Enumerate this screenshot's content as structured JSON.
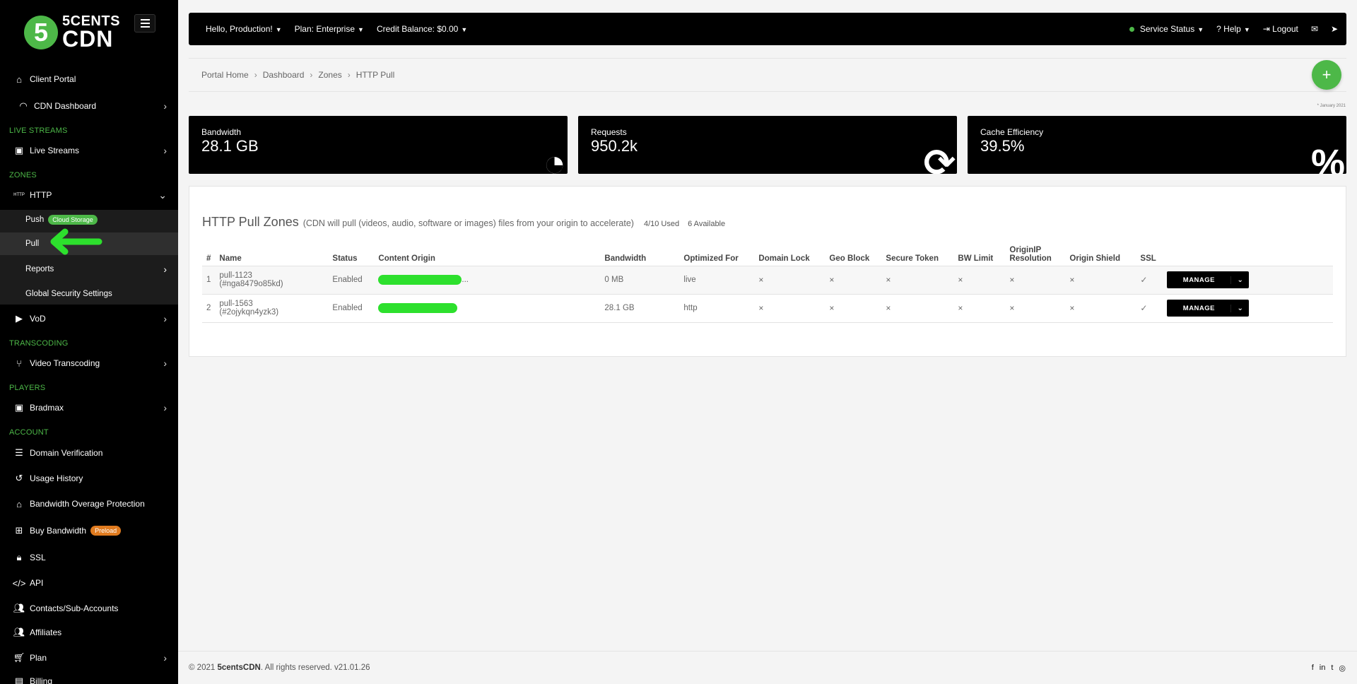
{
  "brand": {
    "logo_mark": "5",
    "line1": "5CENTS",
    "line2": "CDN"
  },
  "sidebar": {
    "client_portal": "Client Portal",
    "cdn_dashboard": "CDN Dashboard",
    "section_live": "LIVE STREAMS",
    "live_streams": "Live Streams",
    "section_zones": "ZONES",
    "http": "HTTP",
    "push": "Push",
    "push_badge": "Cloud Storage",
    "pull": "Pull",
    "reports": "Reports",
    "global_security": "Global Security Settings",
    "vod": "VoD",
    "section_transcoding": "TRANSCODING",
    "video_transcoding": "Video Transcoding",
    "section_players": "PLAYERS",
    "bradmax": "Bradmax",
    "section_account": "ACCOUNT",
    "domain_verification": "Domain Verification",
    "usage_history": "Usage History",
    "bw_overage": "Bandwidth Overage Protection",
    "buy_bandwidth": "Buy Bandwidth",
    "buy_badge": "Preload",
    "ssl": "SSL",
    "api": "API",
    "contacts": "Contacts/Sub-Accounts",
    "affiliates": "Affiliates",
    "plan": "Plan",
    "billing": "Billing"
  },
  "topbar": {
    "hello": "Hello, Production!",
    "plan": "Plan: Enterprise",
    "credit": "Credit Balance: $0.00",
    "service_status": "Service Status",
    "help": "Help",
    "logout": "Logout"
  },
  "breadcrumb": [
    "Portal Home",
    "Dashboard",
    "Zones",
    "HTTP Pull"
  ],
  "date_note": "* January 2021",
  "stats": [
    {
      "label": "Bandwidth",
      "value": "28.1 GB"
    },
    {
      "label": "Requests",
      "value": "950.2k"
    },
    {
      "label": "Cache Efficiency",
      "value": "39.5%"
    }
  ],
  "zones": {
    "title": "HTTP Pull Zones",
    "description": "(CDN will pull (videos, audio, software or images) files from your origin to accelerate)",
    "used": "4/10 Used",
    "available": "6 Available",
    "columns": [
      "#",
      "Name",
      "Status",
      "Content Origin",
      "Bandwidth",
      "Optimized For",
      "Domain Lock",
      "Geo Block",
      "Secure Token",
      "BW Limit",
      "OriginIP Resolution",
      "Origin Shield",
      "SSL"
    ],
    "rows": [
      {
        "num": "1",
        "name": "pull-1123",
        "id": "(#nga8479o85kd)",
        "status": "Enabled",
        "origin_tail": "...",
        "bandwidth": "0 MB",
        "optimized": "live",
        "x": "×",
        "ssl": "✓",
        "manage": "MANAGE"
      },
      {
        "num": "2",
        "name": "pull-1563",
        "id": "(#2ojykqn4yzk3)",
        "status": "Enabled",
        "origin_tail": "",
        "bandwidth": "28.1 GB",
        "optimized": "http",
        "x": "×",
        "ssl": "✓",
        "manage": "MANAGE"
      }
    ]
  },
  "footer": {
    "prefix": "© 2021 ",
    "brand": "5centsCDN",
    "suffix": ". All rights reserved. v21.01.26"
  }
}
